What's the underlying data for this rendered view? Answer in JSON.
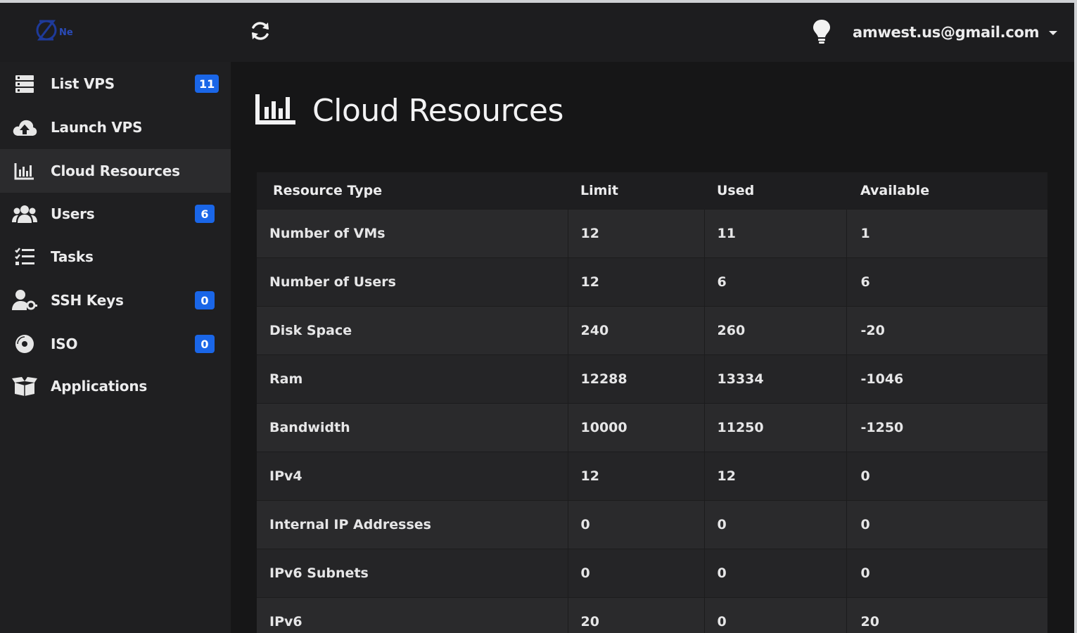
{
  "header": {
    "user_email": "amwest.us@gmail.com",
    "logo_text": "Ne"
  },
  "sidebar": {
    "items": [
      {
        "label": "List VPS",
        "icon": "list-icon",
        "badge": "11"
      },
      {
        "label": "Launch VPS",
        "icon": "cloud-upload-icon"
      },
      {
        "label": "Cloud Resources",
        "icon": "bar-chart-icon",
        "active": true
      },
      {
        "label": "Users",
        "icon": "users-icon",
        "badge": "6"
      },
      {
        "label": "Tasks",
        "icon": "tasks-icon"
      },
      {
        "label": "SSH Keys",
        "icon": "user-key-icon",
        "badge": "0"
      },
      {
        "label": "ISO",
        "icon": "disc-icon",
        "badge": "0"
      },
      {
        "label": "Applications",
        "icon": "box-icon"
      }
    ]
  },
  "main": {
    "title": "Cloud Resources",
    "table": {
      "headers": [
        "Resource Type",
        "Limit",
        "Used",
        "Available"
      ],
      "rows": [
        [
          "Number of VMs",
          "12",
          "11",
          "1"
        ],
        [
          "Number of Users",
          "12",
          "6",
          "6"
        ],
        [
          "Disk Space",
          "240",
          "260",
          "-20"
        ],
        [
          "Ram",
          "12288",
          "13334",
          "-1046"
        ],
        [
          "Bandwidth",
          "10000",
          "11250",
          "-1250"
        ],
        [
          "IPv4",
          "12",
          "12",
          "0"
        ],
        [
          "Internal IP Addresses",
          "0",
          "0",
          "0"
        ],
        [
          "IPv6 Subnets",
          "0",
          "0",
          "0"
        ],
        [
          "IPv6",
          "20",
          "0",
          "20"
        ]
      ]
    }
  },
  "colors": {
    "accent": "#1a66e8",
    "background": "#161617",
    "sidebar": "#1f1f21"
  }
}
